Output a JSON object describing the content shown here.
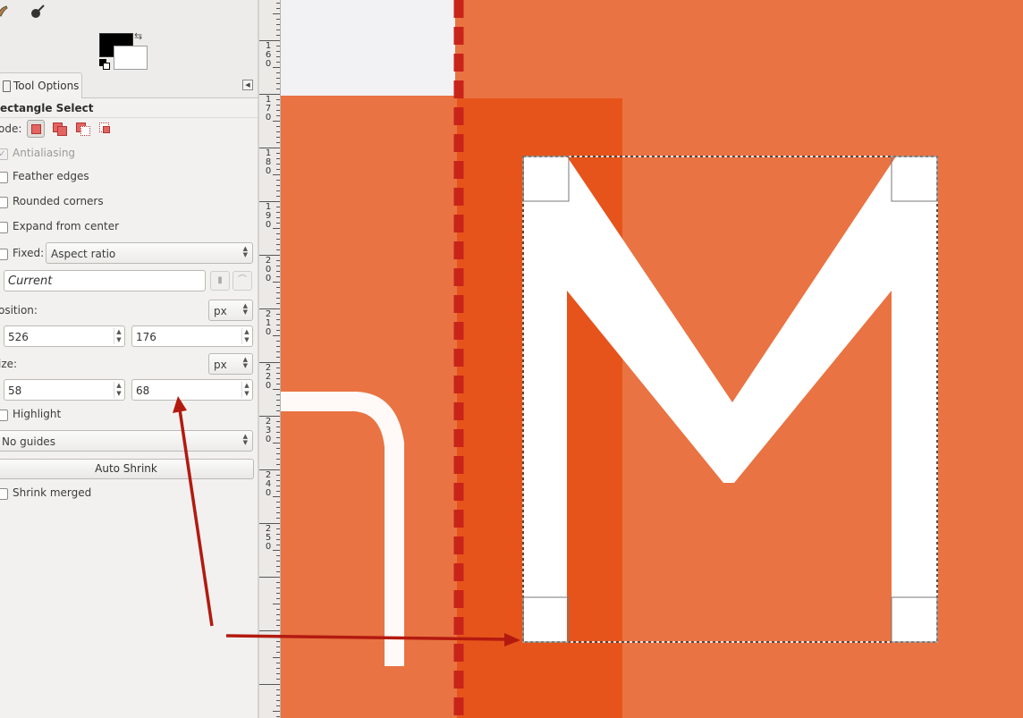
{
  "toolbox": {
    "icons": [
      "smudge-icon",
      "brush-icon"
    ],
    "foreground_color": "#000000",
    "background_color": "#ffffff"
  },
  "tab": {
    "label": "Tool Options"
  },
  "tool": {
    "title": "ectangle Select",
    "mode_label": "ode:",
    "antialiasing": {
      "label": "Antialiasing",
      "checked": true,
      "disabled": true
    },
    "feather": {
      "label": "Feather edges",
      "checked": false
    },
    "rounded": {
      "label": "Rounded corners",
      "checked": false
    },
    "expand": {
      "label": "Expand from center",
      "checked": false
    },
    "fixed": {
      "label": "Fixed:",
      "value": "Aspect ratio",
      "checked": false
    },
    "preset": {
      "value": "Current"
    },
    "position": {
      "label": "osition:",
      "unit": "px",
      "x": "526",
      "y": "176"
    },
    "size": {
      "label": "ize:",
      "unit": "px",
      "w": "58",
      "h": "68"
    },
    "highlight": {
      "label": "Highlight",
      "checked": false
    },
    "guides": {
      "value": "No guides"
    },
    "autoshrink": {
      "label": "Auto Shrink"
    },
    "shrink_merged": {
      "label": "Shrink merged",
      "checked": false
    }
  },
  "ruler": {
    "labels": [
      "160",
      "170",
      "180",
      "190",
      "200",
      "210",
      "220",
      "230",
      "240",
      "250"
    ]
  },
  "colors": {
    "accent": "#e97342",
    "overlay": "#e85a1e",
    "arrow": "#b31a0f",
    "dash": "#c9241a"
  }
}
